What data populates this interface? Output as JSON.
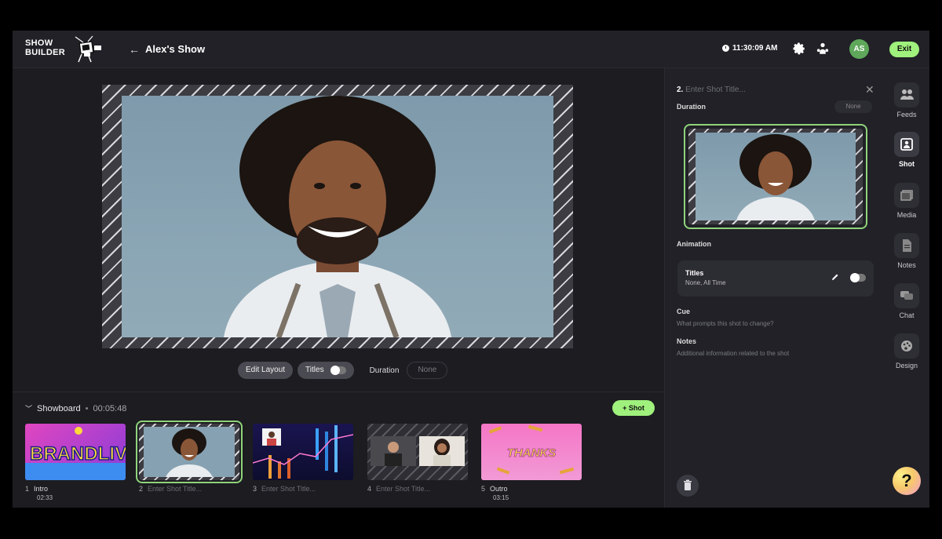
{
  "app": {
    "logo_line1": "SHOW",
    "logo_line2": "BUILDER",
    "show_title": "Alex's Show",
    "clock": "11:30:09 AM",
    "avatar_initials": "AS",
    "exit_label": "Exit",
    "accent": "#9ff07c"
  },
  "stage": {
    "edit_layout": "Edit Layout",
    "titles": "Titles",
    "duration_label": "Duration",
    "duration_value": "None"
  },
  "showboard": {
    "label": "Showboard",
    "total_time": "00:05:48",
    "add_shot": "+ Shot",
    "shots": [
      {
        "num": "1",
        "title": "Intro",
        "duration": "02:33",
        "card_text": "BRANDLIVE"
      },
      {
        "num": "2",
        "placeholder": "Enter Shot Title..."
      },
      {
        "num": "3",
        "placeholder": "Enter Shot Title..."
      },
      {
        "num": "4",
        "placeholder": "Enter Shot Title..."
      },
      {
        "num": "5",
        "title": "Outro",
        "duration": "03:15",
        "card_text": "THANKS"
      }
    ]
  },
  "panel": {
    "shot_number": "2.",
    "shot_title_placeholder": "Enter Shot Title...",
    "duration_label": "Duration",
    "duration_value": "None",
    "animation_label": "Animation",
    "titles_title": "Titles",
    "titles_sub": "None, All Time",
    "cue_label": "Cue",
    "cue_hint": "What prompts this shot to change?",
    "notes_label": "Notes",
    "notes_hint": "Additional information related to the shot"
  },
  "rail": [
    {
      "label": "Feeds",
      "icon": "people-icon"
    },
    {
      "label": "Shot",
      "icon": "shot-icon"
    },
    {
      "label": "Media",
      "icon": "media-icon"
    },
    {
      "label": "Notes",
      "icon": "notes-icon"
    },
    {
      "label": "Chat",
      "icon": "chat-icon"
    },
    {
      "label": "Design",
      "icon": "palette-icon"
    }
  ],
  "help_label": "?"
}
